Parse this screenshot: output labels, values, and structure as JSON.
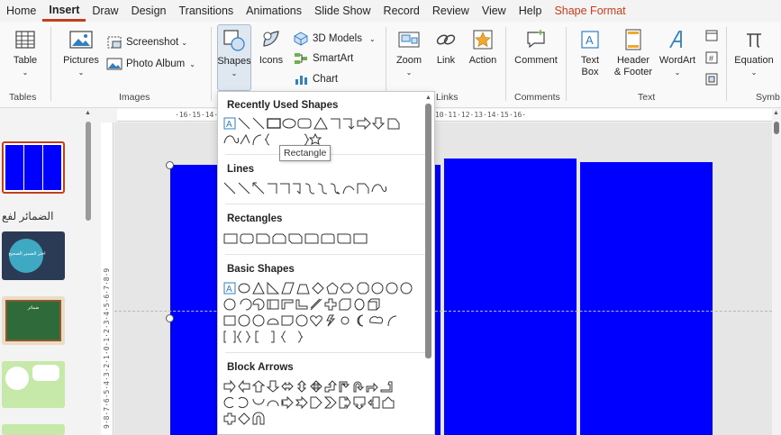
{
  "tabs": [
    {
      "label": "Home"
    },
    {
      "label": "Insert"
    },
    {
      "label": "Draw"
    },
    {
      "label": "Design"
    },
    {
      "label": "Transitions"
    },
    {
      "label": "Animations"
    },
    {
      "label": "Slide Show"
    },
    {
      "label": "Record"
    },
    {
      "label": "Review"
    },
    {
      "label": "View"
    },
    {
      "label": "Help"
    },
    {
      "label": "Shape Format"
    }
  ],
  "ribbon": {
    "tables": {
      "table_label": "Table",
      "group": "Tables"
    },
    "images": {
      "pictures_label": "Pictures",
      "screenshot_label": "Screenshot",
      "photo_album_label": "Photo Album",
      "group": "Images"
    },
    "illustrations": {
      "shapes_label": "Shapes",
      "icons_label": "Icons",
      "models_label": "3D Models",
      "smartart_label": "SmartArt",
      "chart_label": "Chart"
    },
    "links": {
      "zoom_label": "Zoom",
      "link_label": "Link",
      "action_label": "Action",
      "group": "Links"
    },
    "comments": {
      "comment_label": "Comment",
      "group": "Comments"
    },
    "text": {
      "textbox_line1": "Text",
      "textbox_line2": "Box",
      "header_line1": "Header",
      "header_line2": "& Footer",
      "wordart_label": "WordArt",
      "group": "Text"
    },
    "symbols": {
      "equation_label": "Equation",
      "group": "Symb"
    }
  },
  "shapes_menu": {
    "sections": [
      {
        "title": "Recently Used Shapes"
      },
      {
        "title": "Lines"
      },
      {
        "title": "Rectangles"
      },
      {
        "title": "Basic Shapes"
      },
      {
        "title": "Block Arrows"
      }
    ],
    "tooltip": "Rectangle"
  },
  "thumbnails": {
    "arabic_caption": "الضمائر لفع",
    "thumb2_text": "اختر الضمير الصحيح",
    "thumb3_text": "ضمائر"
  },
  "rulers": {
    "horizontal": "·16·15·14·13·12·11·10·9·8·7·6·5·4·3·2·1·0·1·2·3·4·5·6·7·8·9·10·11·12·13·14·15·16·",
    "vertical": "9·8·7·6·5·4·3·2·1·0·1·2·3·4·5·6·7·8·9"
  },
  "colors": {
    "accent": "#c43e1c",
    "shape_fill": "#0000ff"
  }
}
